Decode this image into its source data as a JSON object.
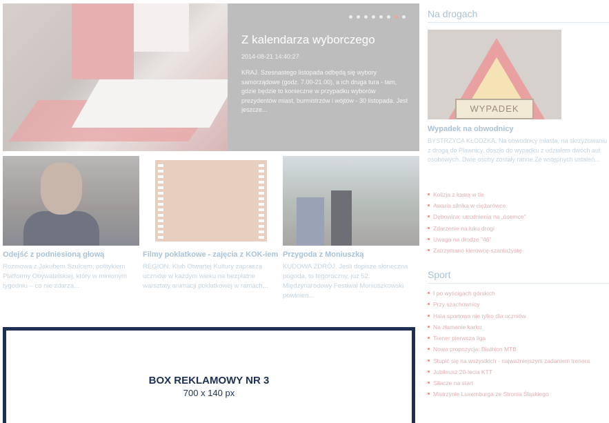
{
  "hero": {
    "title": "Z kalendarza wyborczego",
    "date": "2014-08-21 14:40:27",
    "text": "KRAJ. Szesnastego listopada odbędą się wybory samorządowe (godz. 7.00-21.00), a ich druga tura - tam, gdzie będzie to konieczne w przypadku wyborów prezydentów miast, burmistrzów i wójtów - 30 listopada. Jest jeszcze...",
    "dots_count": 8,
    "active_dot": 6
  },
  "tiles": [
    {
      "title": "Odejść z podniesioną głową",
      "text": "Rozmowa z Jakubem Szulcem, politykiem Platformy Obywatelskiej, który w minionym tygodniu – co nie zdarza..."
    },
    {
      "title": "Filmy poklatkowe - zajęcia z KOK-iem",
      "text": "REGION. Klub Otwartej Kultury zaprasza uczniów w każdym wieku na bezpłatne warsztaty animacji poklatkowej w ramach..."
    },
    {
      "title": "Przygoda z Moniuszką",
      "text": "KUDOWA ZDRÓJ. Jeśli dopisze słoneczna pogoda, to tegoroczny, już 52. Międzynarodowy Festiwal Moniuszkowski powinien..."
    }
  ],
  "ad": {
    "line1": "BOX REKLAMOWY NR 3",
    "line2": "700 x 140 px"
  },
  "na_drogach": {
    "heading": "Na drogach",
    "image_sign": "WYPADEK",
    "feature_title": "Wypadek na obwodnicy",
    "feature_text": "BYSTRZYCA KŁODZKA. Na obwodnicy miasta, na skrzyżowaniu z drogą do Pławnicy, doszło do wypadku z udziałem dwóch aut osobowych. Dwie osoby zostały ranne.Ze wstępnych ustaleń...",
    "items": [
      "Kolizja z kawą w tle",
      "Awaria silnika w ciężarówce",
      "Dębowina: utrudnienia na „ósemce\"",
      "Zdarzenie na łuku drogi",
      "Uwaga na drodze \"46\"",
      "Zatrzymano kierowcę-szantażystę"
    ]
  },
  "sport": {
    "heading": "Sport",
    "items": [
      "I po wyścigach górskich",
      "Przy szachownicy",
      "Hala sportowa nie tylko dla uczniów",
      "Na złamanie karku",
      "Trener pierwsza liga",
      "Nowa propozycja: Biathlon MTB",
      "Stupić się na wszystkich - najważniejszym zadaniem trenera",
      "Jubileusz 20-lecia KTT",
      "Siłacze na start",
      "Mistrzynie Luxemburga ze Stronia Śląskiego"
    ]
  }
}
